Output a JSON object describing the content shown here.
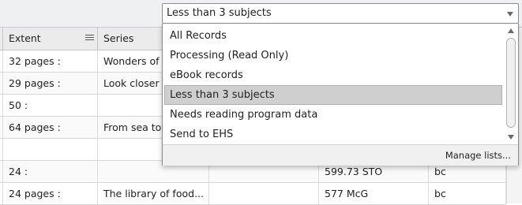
{
  "grid": {
    "columns": [
      {
        "label": "Extent"
      },
      {
        "label": "Series"
      }
    ],
    "rows": [
      {
        "extent": "32 pages :",
        "series": "Wonders of",
        "col3": "",
        "call_number": "",
        "col5": ""
      },
      {
        "extent": "29 pages :",
        "series": "Look closer",
        "col3": "",
        "call_number": "",
        "col5": ""
      },
      {
        "extent": "50 :",
        "series": "",
        "col3": "",
        "call_number": "",
        "col5": ""
      },
      {
        "extent": "64 pages :",
        "series": "From sea to",
        "col3": "",
        "call_number": "",
        "col5": ""
      },
      {
        "extent": "",
        "series": "",
        "col3": "",
        "call_number": "",
        "col5": ""
      },
      {
        "extent": "24 :",
        "series": "",
        "col3": "",
        "call_number": "599.73 STO",
        "col5": "bc"
      },
      {
        "extent": "24 pages :",
        "series": "The library of food...",
        "col3": "",
        "call_number": "577 McG",
        "col5": "bc"
      }
    ]
  },
  "list_select": {
    "selected": "Less than 3 subjects",
    "options": [
      {
        "label": "All Records"
      },
      {
        "label": "Processing (Read Only)"
      },
      {
        "label": "eBook records"
      },
      {
        "label": "Less than 3 subjects"
      },
      {
        "label": "Needs reading program data"
      },
      {
        "label": "Send to EHS"
      }
    ],
    "selected_index": 3,
    "manage_label": "Manage lists..."
  },
  "icons": {
    "column_menu": "column-menu-icon",
    "select_arrow": "chevron-down-icon"
  },
  "colors": {
    "selected_option_bg": "#cfcfcf",
    "header_bg": "#ebebeb",
    "toolbar_bg": "#eef0f2"
  }
}
